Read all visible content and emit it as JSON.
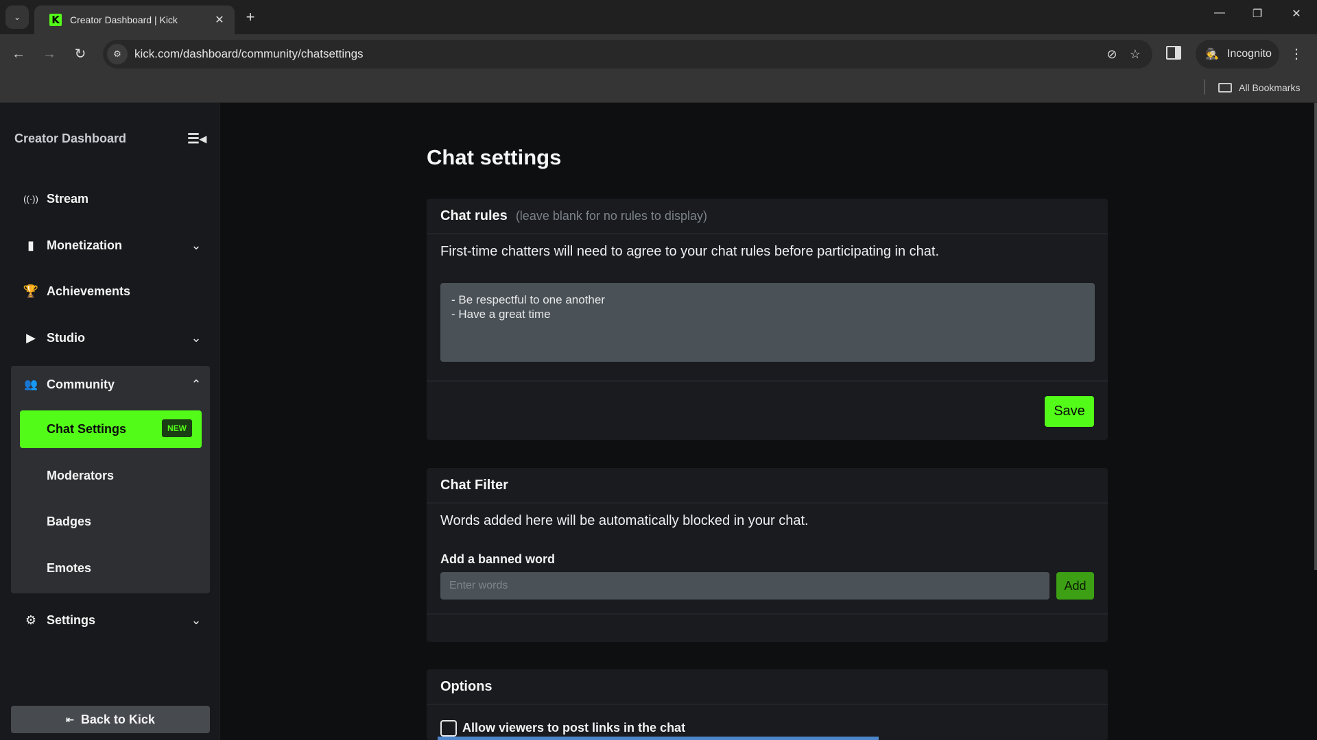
{
  "browser": {
    "tab_title": "Creator Dashboard | Kick",
    "favicon_letter": "K",
    "url": "kick.com/dashboard/community/chatsettings",
    "profile_label": "Incognito",
    "bookmarks_label": "All Bookmarks",
    "icons": {
      "tab_search": "⌄",
      "close_tab": "✕",
      "new_tab": "+",
      "minimize": "—",
      "maximize": "❐",
      "close_window": "✕",
      "back": "←",
      "forward": "→",
      "reload": "↻",
      "site_info": "⚙",
      "eye_off": "⊘",
      "star": "☆",
      "incognito": "🕵",
      "menu": "⋮"
    }
  },
  "sidebar": {
    "title": "Creator Dashboard",
    "collapse_icon": "☰◂",
    "items": [
      {
        "label": "Stream",
        "icon": "((·))",
        "chevron": ""
      },
      {
        "label": "Monetization",
        "icon": "▮",
        "chevron": "⌄"
      },
      {
        "label": "Achievements",
        "icon": "🏆",
        "chevron": ""
      },
      {
        "label": "Studio",
        "icon": "▶",
        "chevron": "⌄"
      },
      {
        "label": "Community",
        "icon": "👥",
        "chevron": "⌃"
      },
      {
        "label": "Settings",
        "icon": "⚙",
        "chevron": "⌄"
      }
    ],
    "community_subitems": [
      {
        "label": "Chat Settings",
        "badge": "NEW",
        "active": true
      },
      {
        "label": "Moderators"
      },
      {
        "label": "Badges"
      },
      {
        "label": "Emotes"
      }
    ],
    "back_button": "Back to Kick",
    "back_icon": "⇤"
  },
  "main": {
    "title": "Chat settings",
    "chat_rules": {
      "title": "Chat rules",
      "hint": "(leave blank for no rules to display)",
      "description": "First-time chatters will need to agree to your chat rules before participating in chat.",
      "rules_value": "- Be respectful to one another\n- Have a great time",
      "save_label": "Save"
    },
    "chat_filter": {
      "title": "Chat Filter",
      "description": "Words added here will be automatically blocked in your chat.",
      "field_label": "Add a banned word",
      "placeholder": "Enter words",
      "add_label": "Add"
    },
    "options": {
      "title": "Options",
      "allow_links_label": "Allow viewers to post links in the chat",
      "allow_links_checked": false
    }
  },
  "colors": {
    "accent": "#53fc18",
    "page_bg": "#0e0f11",
    "card_bg": "#191b1f",
    "input_bg": "#4b5257"
  }
}
